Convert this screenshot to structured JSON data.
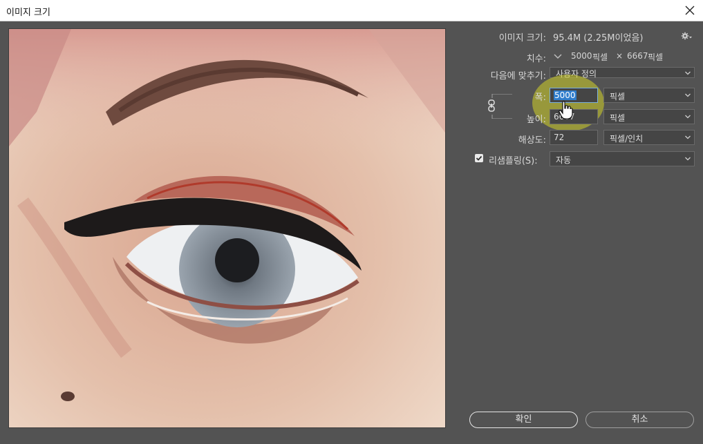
{
  "window": {
    "title": "이미지 크기"
  },
  "info": {
    "image_size_label": "이미지 크기:",
    "image_size_value": "95.4M (2.25M이었음)",
    "dimensions_label": "치수:",
    "dim_width": "5000",
    "dim_width_unit": "픽셀",
    "dim_sep": "×",
    "dim_height": "6667",
    "dim_height_unit": "픽셀"
  },
  "fit": {
    "label": "다음에 맞추기:",
    "value": "사용자 정의"
  },
  "width": {
    "label": "폭:",
    "value": "5000",
    "unit": "픽셀"
  },
  "height": {
    "label": "높이:",
    "value": "6667",
    "unit": "픽셀"
  },
  "resolution": {
    "label": "해상도:",
    "value": "72",
    "unit": "픽셀/인치"
  },
  "resample": {
    "label": "리샘플링(S):",
    "checked": true,
    "value": "자동"
  },
  "buttons": {
    "ok": "확인",
    "cancel": "취소"
  },
  "colors": {
    "background": "#535353",
    "titlebar": "#ffffff",
    "selection": "#2f7dcc",
    "halo": "#d2d228"
  }
}
